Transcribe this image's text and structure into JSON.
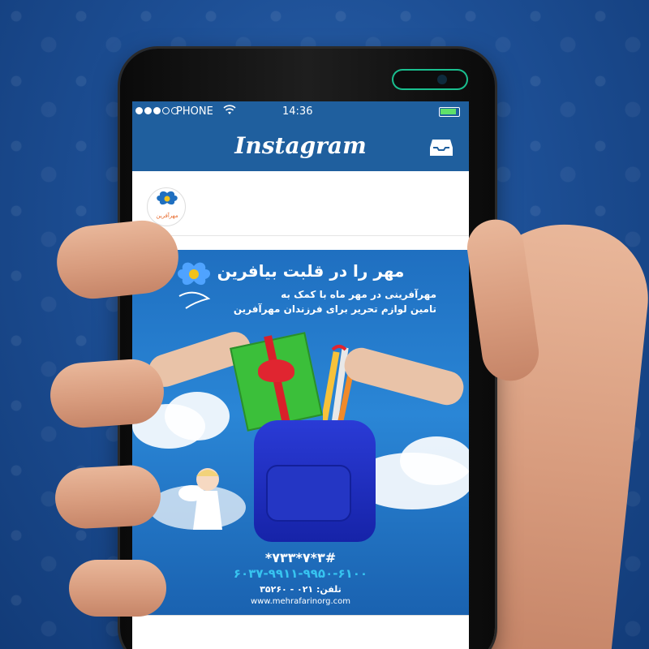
{
  "status_bar": {
    "carrier": "PHONE",
    "time": "14:36",
    "wifi_icon": "wifi-icon",
    "battery_icon": "battery-icon"
  },
  "app": {
    "title": "Instagram",
    "inbox_icon": "inbox-icon"
  },
  "post": {
    "avatar_text": "مهرآفرین",
    "headline": "مهر را در قلبت بیافرین",
    "subline_1": "مهرآفرینی در مهر ماه با کمک به",
    "subline_2": "تامین لوازم تحریر برای فرزندان مهرآفرین",
    "ussd_code": "*۷۳۳*۷*۳#",
    "card_number": "۶۰۳۷-۹۹۱۱-۹۹۵۰-۶۱۰۰",
    "phone": "تلفن: ۰۲۱ - ۳۵۲۶۰",
    "website": "www.mehrafarinorg.com"
  },
  "colors": {
    "header_blue": "#1f5f9e",
    "poster_blue": "#2a86d6",
    "card_cyan": "#37c4f0",
    "bag_blue": "#1623a8",
    "book_green": "#3bbf3a",
    "ribbon_red": "#e02530",
    "camera_accent": "#1abf8f"
  }
}
